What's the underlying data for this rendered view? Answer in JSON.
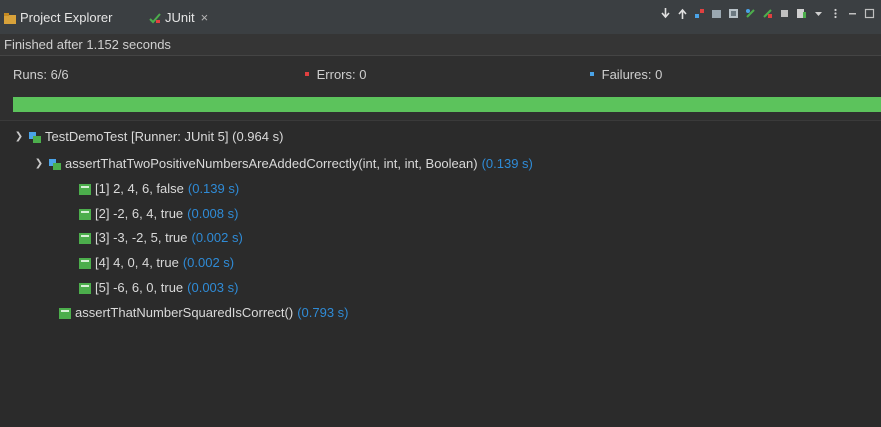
{
  "tabs": [
    {
      "label": "Project Explorer"
    },
    {
      "label": "JUnit",
      "close": "×"
    }
  ],
  "status": {
    "text": "Finished after 1.152 seconds"
  },
  "counters": {
    "runs_label": "Runs:",
    "runs_value": "6/6",
    "errors_label": "Errors:",
    "errors_value": "0",
    "failures_label": "Failures:",
    "failures_value": "0"
  },
  "progress": {
    "value": 1.0,
    "color": "#5cc35c"
  },
  "colors": {
    "time": "#2f8bd6",
    "error": "#e04040",
    "failure": "#4aa3e8",
    "pass": "#4cae4c"
  },
  "tree": {
    "root": {
      "label": "TestDemoTest [Runner: JUnit 5] (0.964 s)"
    },
    "group": {
      "label": "assertThatTwoPositiveNumbersAreAddedCorrectly(int, int, int, Boolean)",
      "time": "(0.139 s)"
    },
    "cases": [
      {
        "label": "[1] 2, 4, 6, false",
        "time": "(0.139 s)"
      },
      {
        "label": "[2] -2, 6, 4, true",
        "time": "(0.008 s)"
      },
      {
        "label": "[3] -3, -2, 5, true",
        "time": "(0.002 s)"
      },
      {
        "label": "[4] 4, 0, 4, true",
        "time": "(0.002 s)"
      },
      {
        "label": "[5] -6, 6, 0, true",
        "time": "(0.003 s)"
      }
    ],
    "single": {
      "label": "assertThatNumberSquaredIsCorrect()",
      "time": "(0.793 s)"
    }
  }
}
